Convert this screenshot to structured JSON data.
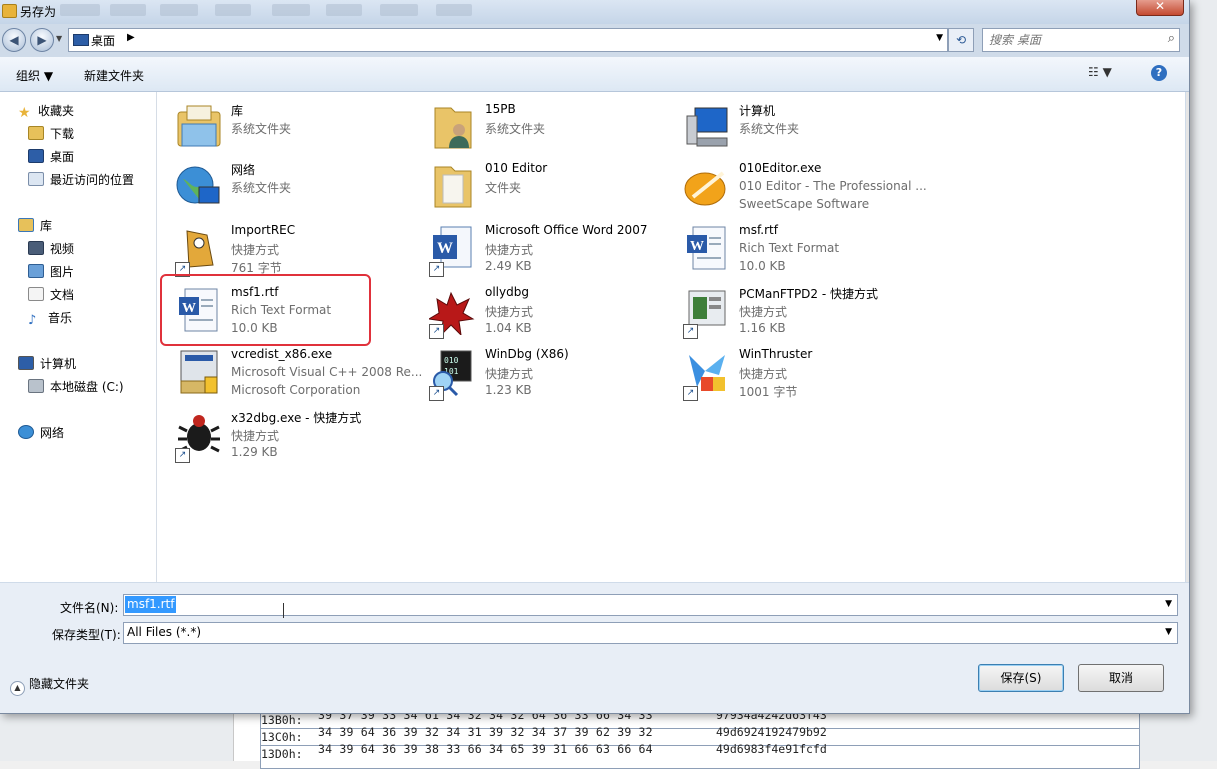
{
  "window": {
    "title": "另存为",
    "close_glyph": "✕"
  },
  "address": {
    "location": "桌面",
    "arrow": "▶",
    "dropdown": "▼",
    "refresh": "⟲"
  },
  "search": {
    "placeholder": "搜索 桌面"
  },
  "toolbar": {
    "organize": "组织 ▼",
    "new_folder": "新建文件夹",
    "view": "☷ ▼",
    "help": "?"
  },
  "sidebar": {
    "favorites": {
      "label": "收藏夹",
      "items": [
        "下载",
        "桌面",
        "最近访问的位置"
      ]
    },
    "libraries": {
      "label": "库",
      "items": [
        "视频",
        "图片",
        "文档",
        "音乐"
      ]
    },
    "computer": {
      "label": "计算机",
      "items": [
        "本地磁盘 (C:)"
      ]
    },
    "network": {
      "label": "网络"
    }
  },
  "files": [
    {
      "name": "库",
      "line2": "系统文件夹",
      "line3": "",
      "icon": "library-icon",
      "shortcut": false
    },
    {
      "name": "15PB",
      "line2": "系统文件夹",
      "line3": "",
      "icon": "user-folder-icon",
      "shortcut": false
    },
    {
      "name": "计算机",
      "line2": "系统文件夹",
      "line3": "",
      "icon": "computer-icon",
      "shortcut": false
    },
    {
      "name": "网络",
      "line2": "系统文件夹",
      "line3": "",
      "icon": "network-globe-icon",
      "shortcut": false
    },
    {
      "name": "010 Editor",
      "line2": "文件夹",
      "line3": "",
      "icon": "folder-icon",
      "shortcut": false
    },
    {
      "name": "010Editor.exe",
      "line2": "010 Editor - The Professional ...",
      "line3": "SweetScape Software",
      "icon": "editor-app-icon",
      "shortcut": false
    },
    {
      "name": "ImportREC",
      "line2": "快捷方式",
      "line3": "761 字节",
      "icon": "importrec-icon",
      "shortcut": true
    },
    {
      "name": "Microsoft Office Word 2007",
      "line2": "快捷方式",
      "line3": "2.49 KB",
      "icon": "word-icon",
      "shortcut": true
    },
    {
      "name": "msf.rtf",
      "line2": "Rich Text Format",
      "line3": "10.0 KB",
      "icon": "rtf-document-icon",
      "shortcut": false
    },
    {
      "name": "msf1.rtf",
      "line2": "Rich Text Format",
      "line3": "10.0 KB",
      "icon": "rtf-document-icon",
      "shortcut": false
    },
    {
      "name": "ollydbg",
      "line2": "快捷方式",
      "line3": "1.04 KB",
      "icon": "ollydbg-icon",
      "shortcut": true
    },
    {
      "name": "PCManFTPD2 - 快捷方式",
      "line2": "快捷方式",
      "line3": "1.16 KB",
      "icon": "ftp-app-icon",
      "shortcut": true
    },
    {
      "name": "vcredist_x86.exe",
      "line2": "Microsoft Visual C++ 2008 Re...",
      "line3": "Microsoft Corporation",
      "icon": "installer-icon",
      "shortcut": false
    },
    {
      "name": "WinDbg (X86)",
      "line2": "快捷方式",
      "line3": "1.23 KB",
      "icon": "windbg-icon",
      "shortcut": true
    },
    {
      "name": "WinThruster",
      "line2": "快捷方式",
      "line3": "1001 字节",
      "icon": "winthruster-icon",
      "shortcut": true
    },
    {
      "name": "x32dbg.exe - 快捷方式",
      "line2": "快捷方式",
      "line3": "1.29 KB",
      "icon": "x32dbg-bug-icon",
      "shortcut": true
    }
  ],
  "form": {
    "filename_label": "文件名(N):",
    "filename_value": "msf1.rtf",
    "filetype_label": "保存类型(T):",
    "filetype_value": "All Files (*.*)"
  },
  "footer": {
    "hide_folders": "隐藏文件夹",
    "save": "保存(S)",
    "cancel": "取消"
  },
  "hex_rows": [
    {
      "addr": "13B0h:",
      "bytes": "39 37 39 33 34 61 34 32 34 32 64 36 33 66 34 33",
      "ascii": "97934a4242d63f43"
    },
    {
      "addr": "13C0h:",
      "bytes": "34 39 64 36 39 32 34 31 39 32 34 37 39 62 39 32",
      "ascii": "49d6924192479b92"
    },
    {
      "addr": "13D0h:",
      "bytes": "34 39 64 36 39 38 33 66 34 65 39 31 66 63 66 64",
      "ascii": "49d6983f4e91fcfd"
    }
  ],
  "colors": {
    "highlight": "#e0313b",
    "selection": "#3399ff",
    "accent": "#2f6fc0"
  }
}
